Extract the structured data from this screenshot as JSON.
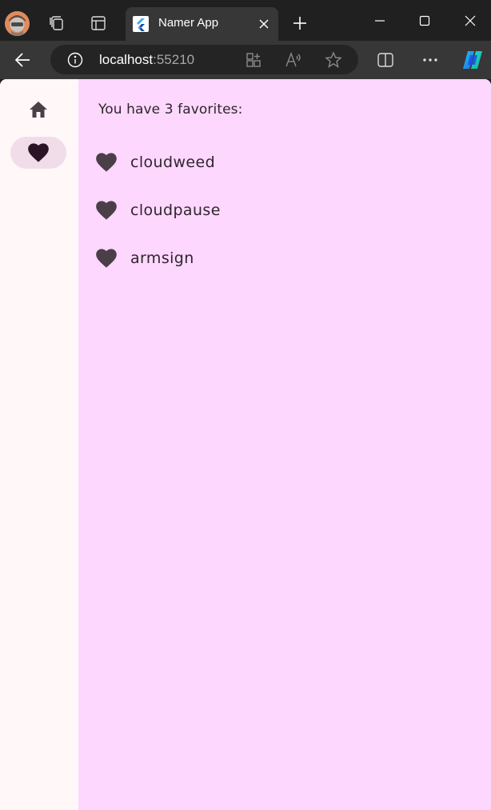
{
  "browser": {
    "tab": {
      "title": "Namer App"
    },
    "address": {
      "host": "localhost",
      "port": ":55210"
    },
    "icons": {
      "profile": "profile-avatar",
      "workspaces": "workspaces-icon",
      "tab_actions": "tab-actions-icon",
      "new_tab": "plus-icon",
      "minimize": "minimize-icon",
      "maximize": "maximize-icon",
      "close": "close-icon",
      "back": "back-arrow-icon",
      "site_info": "info-icon",
      "apps": "apps-icon",
      "read_aloud": "read-aloud-icon",
      "favorite": "star-icon",
      "split_screen": "split-screen-icon",
      "more": "more-icon",
      "copilot": "copilot-icon"
    }
  },
  "app": {
    "rail": {
      "destinations": [
        {
          "icon": "home-icon",
          "selected": false
        },
        {
          "icon": "heart-icon",
          "selected": true
        }
      ]
    },
    "favorites": {
      "header": "You have 3 favorites:",
      "items": [
        {
          "label": "cloudweed"
        },
        {
          "label": "cloudpause"
        },
        {
          "label": "armsign"
        }
      ]
    },
    "colors": {
      "content_bg": "#fed7fe",
      "rail_bg": "#fff7f8",
      "rail_indicator": "#f1dde9",
      "icon": "#4a3f47",
      "selected_icon": "#2b1425"
    }
  }
}
